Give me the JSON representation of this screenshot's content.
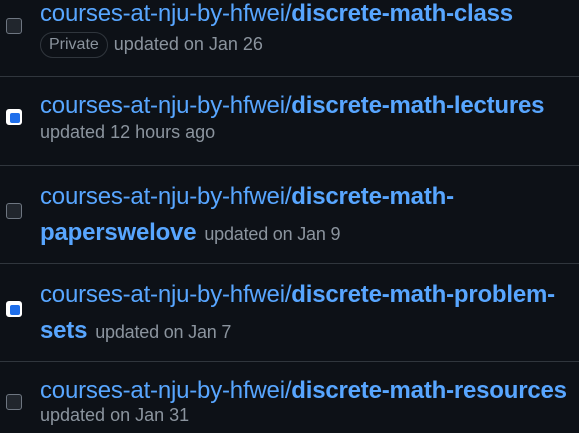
{
  "repos": [
    {
      "owner": "courses-at-nju-by-hfwei/",
      "name": "discrete-math-class",
      "badge": "Private",
      "updated": "updated on Jan 26",
      "checked": false
    },
    {
      "owner": "courses-at-nju-by-hfwei/",
      "name": "discrete-math-lectures",
      "updated": "updated 12 hours ago",
      "checked": true
    },
    {
      "owner": "courses-at-nju-by-hfwei/",
      "name_line1": "discrete-math-",
      "name_line2": "paperswelove",
      "updated": "updated on Jan 9",
      "checked": false
    },
    {
      "owner": "courses-at-nju-by-hfwei/",
      "name_line1": "discrete-math-problem-",
      "name_line2": "sets",
      "updated": "updated on Jan 7",
      "checked": true
    },
    {
      "owner": "courses-at-nju-by-hfwei/",
      "name": "discrete-math-resources",
      "updated": "updated on Jan 31",
      "checked": false
    }
  ],
  "colors": {
    "link": "#58a6ff",
    "muted": "#8b949e",
    "border": "#30363d",
    "background": "#0d1117",
    "checkbox_checked": "#1f6feb"
  }
}
